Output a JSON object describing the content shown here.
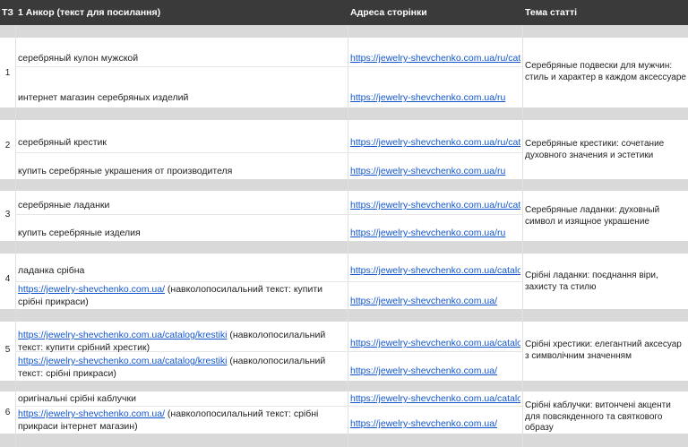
{
  "header": {
    "col_a": "ТЗ",
    "col_b": "1 Анкор (текст для посилання)",
    "col_c": "Адреса сторінки",
    "col_d": "Тема статті"
  },
  "rows": [
    {
      "num": "1",
      "anchor1": "серебряный кулон мужской",
      "anchor2": "интернет магазин серебряных изделий",
      "url1": "https://jewelry-shevchenko.com.ua/ru/cata",
      "url2": "https://jewelry-shevchenko.com.ua/ru",
      "topic": "Серебряные подвески для мужчин: стиль и характер в каждом аксессуаре"
    },
    {
      "num": "2",
      "anchor1": "серебряный крестик",
      "anchor2": "купить серебряные украшения от производителя",
      "url1": "https://jewelry-shevchenko.com.ua/ru/cata",
      "url2": "https://jewelry-shevchenko.com.ua/ru",
      "topic": "Серебряные крестики: сочетание духовного значения и эстетики"
    },
    {
      "num": "3",
      "anchor1": "серебряные ладанки",
      "anchor2": "купить серебряные изделия",
      "url1": "https://jewelry-shevchenko.com.ua/ru/cata",
      "url2": "https://jewelry-shevchenko.com.ua/ru",
      "topic": "Серебряные ладанки: духовный символ и изящное украшение"
    },
    {
      "num": "4",
      "anchor1": "ладанка срібна",
      "anchor2_link": "https://jewelry-shevchenko.com.ua/",
      "anchor2_text": " (навколопосилальний текст: купити срібні прикраси)",
      "url1": "https://jewelry-shevchenko.com.ua/catalog",
      "url2": "https://jewelry-shevchenko.com.ua/",
      "topic": "Срібні ладанки: поєднання віри, захисту та стилю"
    },
    {
      "num": "5",
      "anchor1_link": "https://jewelry-shevchenko.com.ua/catalog/krestiki",
      "anchor1_text": " (навколопосилальний текст: купити срібний хрестик)",
      "anchor2_link": "https://jewelry-shevchenko.com.ua/catalog/krestiki",
      "anchor2_text": " (навколопосилальний текст: срібні прикраси)",
      "url1": "https://jewelry-shevchenko.com.ua/catalog",
      "url2": "https://jewelry-shevchenko.com.ua/",
      "topic": "Срібні хрестики: елегантний аксесуар з символічним значенням"
    },
    {
      "num": "6",
      "anchor1": "оригінальні срібні каблучки",
      "anchor2_link": "https://jewelry-shevchenko.com.ua/",
      "anchor2_text": " (навколопосилальний текст: срібні прикраси інтернет магазин)",
      "url1": "https://jewelry-shevchenko.com.ua/catalog",
      "url2": "https://jewelry-shevchenko.com.ua/",
      "topic": "Срібні каблучки: витончені акценти для повсякденного та святкового образу"
    }
  ]
}
